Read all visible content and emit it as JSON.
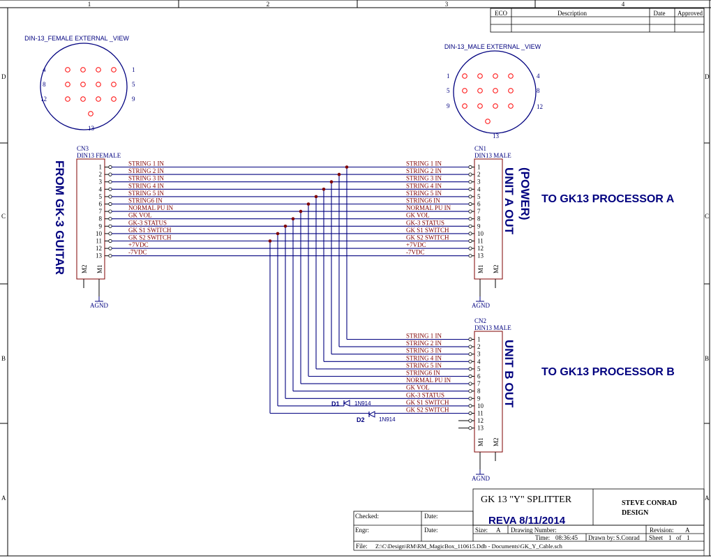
{
  "border": {
    "top_numbers": [
      "1",
      "2",
      "3",
      "4"
    ],
    "side_letters": [
      "D",
      "C",
      "B",
      "A"
    ]
  },
  "eco_table": {
    "headers": [
      "ECO",
      "Description",
      "Date",
      "Approved"
    ]
  },
  "connectors": {
    "female_view": {
      "title": "DIN-13_FEMALE EXTERNAL _VIEW",
      "pin_labels": [
        "4",
        "8",
        "12",
        "1",
        "5",
        "9",
        "13"
      ]
    },
    "male_view": {
      "title": "DIN-13_MALE EXTERNAL _VIEW",
      "pin_labels": [
        "1",
        "5",
        "9",
        "4",
        "8",
        "12",
        "13"
      ]
    },
    "cn3": {
      "ref": "CN3",
      "type": "DIN13 FEMALE",
      "m_pins": [
        "M2",
        "M1"
      ]
    },
    "cn1": {
      "ref": "CN1",
      "type": "DIN13 MALE",
      "m_pins": [
        "M1",
        "M2"
      ]
    },
    "cn2": {
      "ref": "CN2",
      "type": "DIN13 MALE",
      "m_pins": [
        "M1",
        "M2"
      ]
    },
    "pin_numbers": [
      "1",
      "2",
      "3",
      "4",
      "5",
      "6",
      "7",
      "8",
      "9",
      "10",
      "11",
      "12",
      "13"
    ],
    "ground_label": "AGND"
  },
  "signals": {
    "cn3_cn1": [
      "STRING 1  IN",
      "STRING 2  IN",
      "STRING 3  IN",
      "STRING 4  IN",
      "STRING 5  IN",
      "STRING6  IN",
      "NORMAL PU  IN",
      "GK  VOL",
      "GK-3 STATUS",
      "GK S1 SWITCH",
      "GK S2 SWITCH",
      "+7VDC",
      "-7VDC"
    ],
    "cn2": [
      "STRING 1  IN",
      "STRING 2  IN",
      "STRING 3  IN",
      "STRING 4  IN",
      "STRING 5  IN",
      "STRING6  IN",
      "NORMAL PU  IN",
      "GK  VOL",
      "GK-3 STATUS",
      "GK S1 SWITCH",
      "GK S2 SWITCH"
    ]
  },
  "diodes": [
    {
      "ref": "D1",
      "part": "1N914"
    },
    {
      "ref": "D2",
      "part": "1N914"
    }
  ],
  "annotations": {
    "from_gk3": "FROM GK-3 GUITAR",
    "unit_a_1": "UNIT A OUT",
    "unit_a_2": "(POWER)",
    "to_proc_a": "TO GK13 PROCESSOR A",
    "unit_b": "UNIT B OUT",
    "to_proc_b": "TO GK13 PROCESSOR B"
  },
  "title_block": {
    "title": "GK 13 \"Y\" SPLITTER",
    "company_line1": "STEVE CONRAD",
    "company_line2": "DESIGN",
    "revision_banner": "REVA 8/11/2014",
    "checked_label": "Checked:",
    "date_label_1": "Date:",
    "engr_label": "Engr:",
    "date_label_2": "Date:",
    "size_label": "Size:",
    "size_value": "A",
    "drawing_number_label": "Drawing Number:",
    "revision_label": "Revision:",
    "revision_value": "A",
    "time_label": "Time:",
    "time_value": "08:36:45",
    "drawn_by_label": "Drawn by:",
    "drawn_by_value": "S.Conrad",
    "sheet_label": "Sheet",
    "sheet_value": "1",
    "sheet_of": "of",
    "sheet_total": "1",
    "file_label": "File:",
    "file_value": "Z:\\C\\Design\\RM\\RM_MagicBox_110615.Ddb - Documents\\GK_Y_Cable.sch"
  },
  "colors": {
    "border": "#000000",
    "wire": "#00007f",
    "component": "#7f0000",
    "pin_text": "#000000",
    "net_label": "#7f0000",
    "ref_text": "#00007f",
    "junction": "#7f0000",
    "view_circle": "#00007f",
    "view_pin": "#ff0000"
  }
}
